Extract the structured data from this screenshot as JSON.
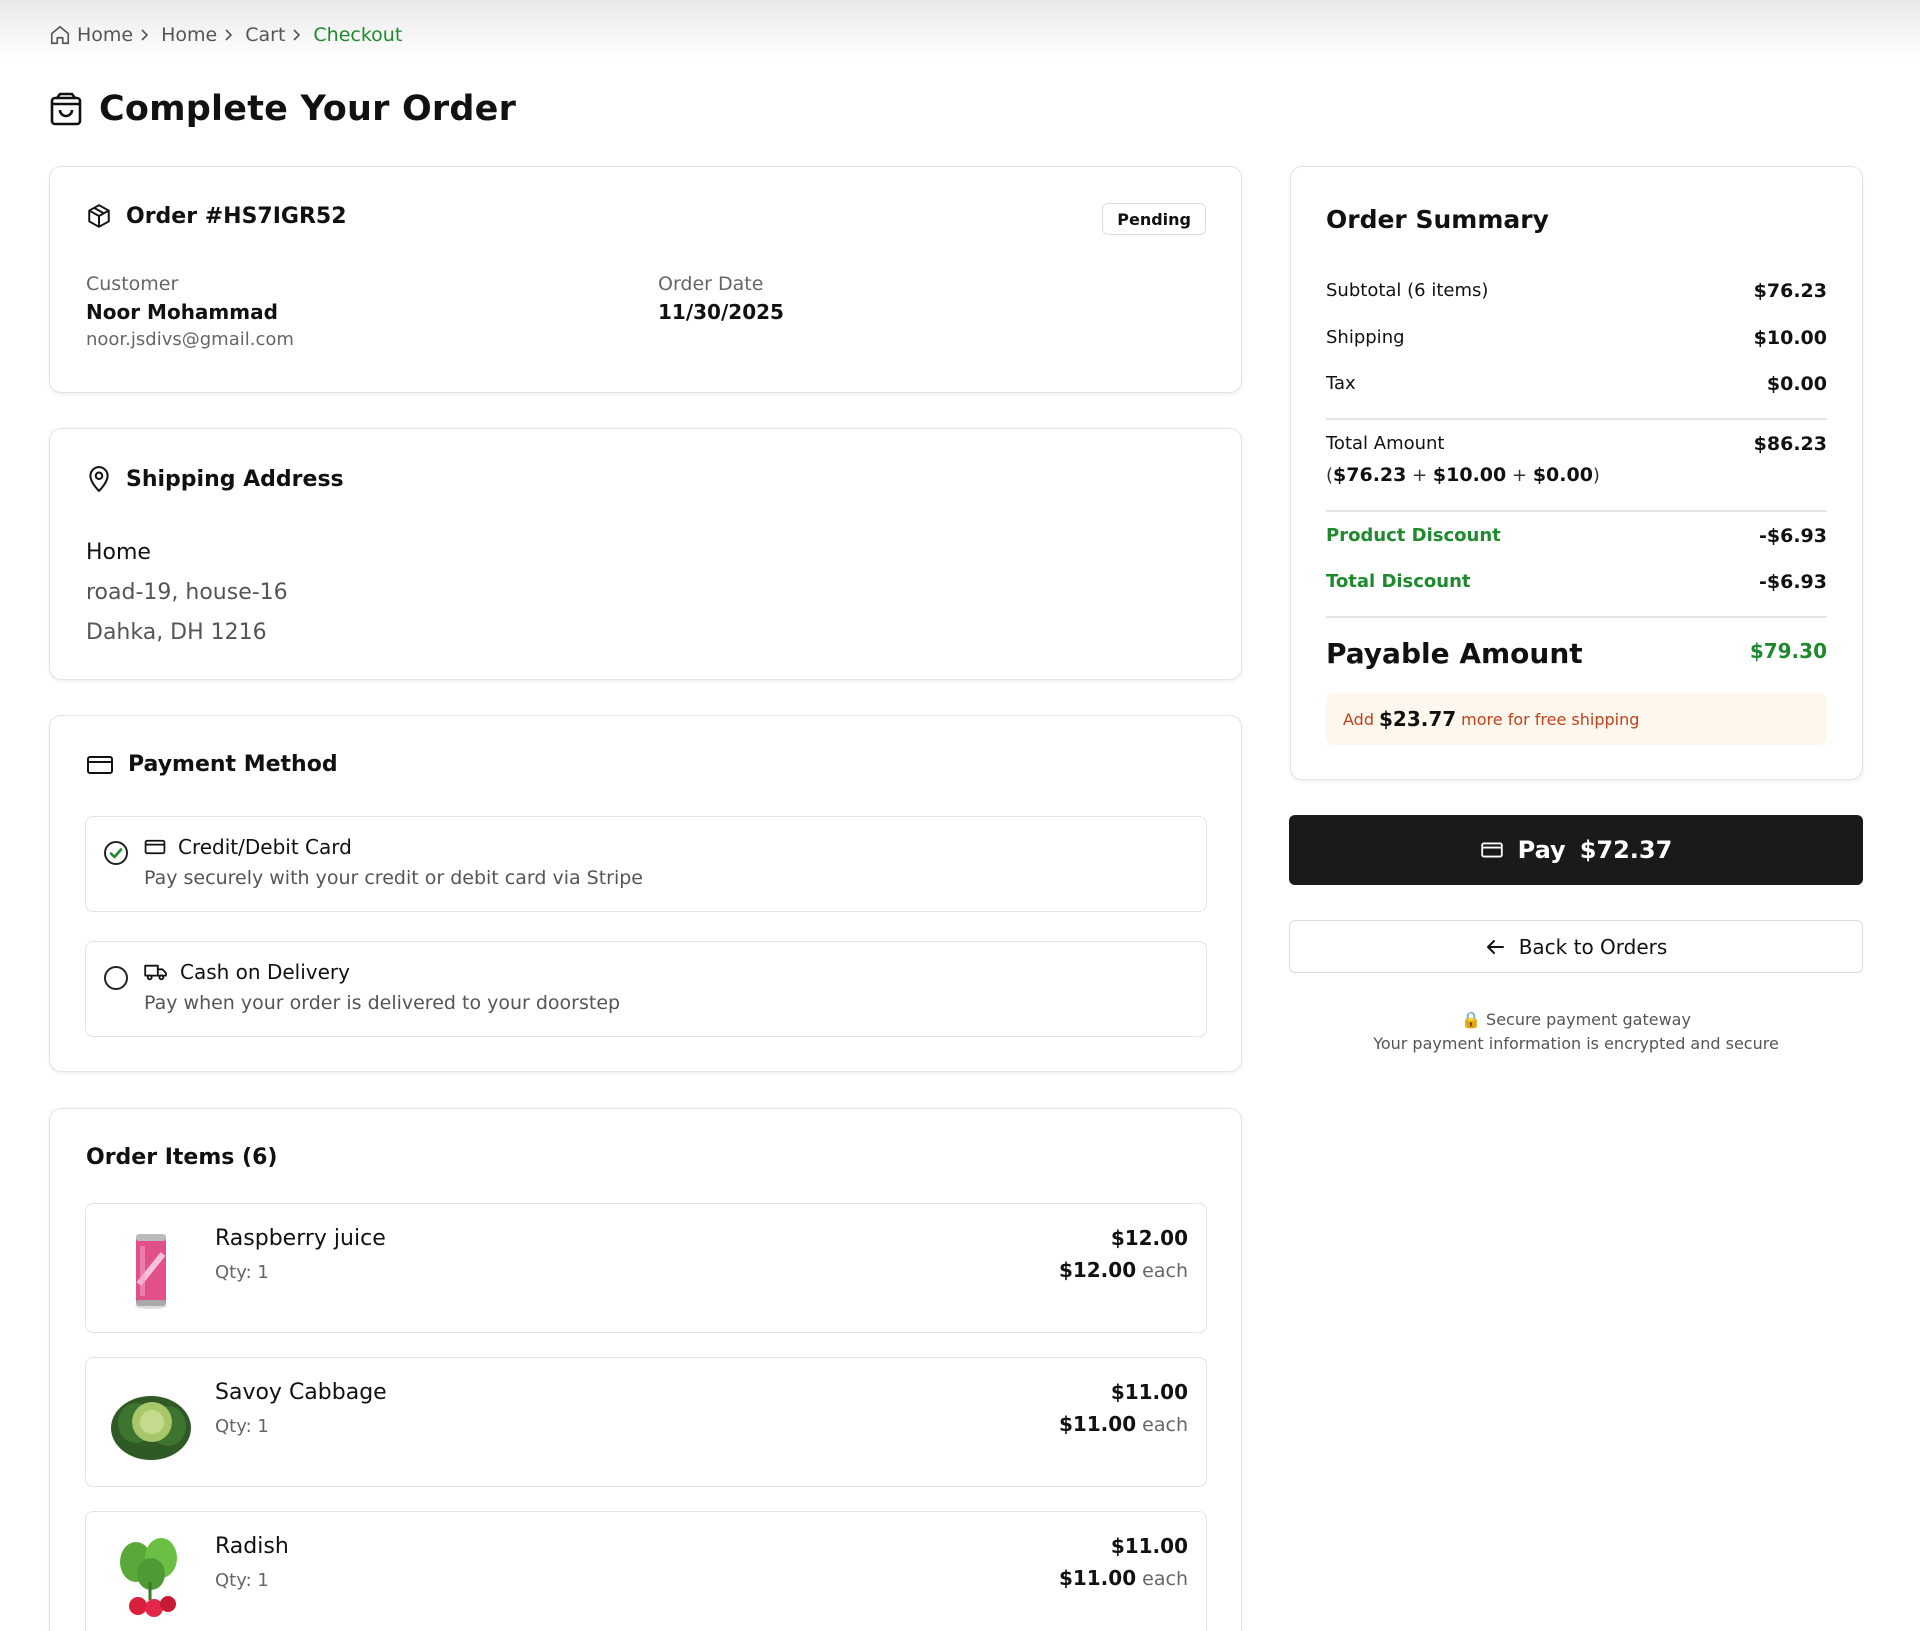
{
  "breadcrumb": {
    "items": [
      "Home",
      "Home",
      "Cart"
    ],
    "current": "Checkout"
  },
  "page": {
    "title": "Complete Your Order"
  },
  "order": {
    "heading": "Order #HS7IGR52",
    "status": "Pending",
    "customer_label": "Customer",
    "customer_name": "Noor Mohammad",
    "customer_email": "noor.jsdivs@gmail.com",
    "date_label": "Order Date",
    "date": "11/30/2025"
  },
  "shipping": {
    "heading": "Shipping Address",
    "name": "Home",
    "line1": "road-19, house-16",
    "line2": "Dahka, DH 1216"
  },
  "payment": {
    "heading": "Payment Method",
    "options": [
      {
        "title": "Credit/Debit Card",
        "desc": "Pay securely with your credit or debit card via Stripe",
        "selected": true
      },
      {
        "title": "Cash on Delivery",
        "desc": "Pay when your order is delivered to your doorstep",
        "selected": false
      }
    ]
  },
  "items": {
    "heading": "Order Items (6)",
    "list": [
      {
        "name": "Raspberry juice",
        "qty": "Qty: 1",
        "total": "$12.00",
        "unit": "$12.00",
        "each": "each",
        "image": "juice-can"
      },
      {
        "name": "Savoy Cabbage",
        "qty": "Qty: 1",
        "total": "$11.00",
        "unit": "$11.00",
        "each": "each",
        "image": "cabbage"
      },
      {
        "name": "Radish",
        "qty": "Qty: 1",
        "total": "$11.00",
        "unit": "$11.00",
        "each": "each",
        "image": "radish"
      }
    ]
  },
  "summary": {
    "title": "Order Summary",
    "subtotal_label": "Subtotal (6 items)",
    "subtotal": "$76.23",
    "shipping_label": "Shipping",
    "shipping": "$10.00",
    "tax_label": "Tax",
    "tax": "$0.00",
    "total_label": "Total Amount",
    "total": "$86.23",
    "breakdown": {
      "open": "(",
      "a": "$76.23",
      "plus1": "+",
      "b": "$10.00",
      "plus2": "+",
      "c": "$0.00",
      "close": ")"
    },
    "product_discount_label": "Product Discount",
    "product_discount": "-$6.93",
    "total_discount_label": "Total Discount",
    "total_discount": "-$6.93",
    "payable_label": "Payable Amount",
    "payable": "$79.30",
    "free_ship": {
      "prefix": "Add",
      "amount": "$23.77",
      "suffix": "more for free shipping"
    }
  },
  "actions": {
    "pay_label": "Pay",
    "pay_amount": "$72.37",
    "back_label": "Back to Orders"
  },
  "secure": {
    "line1": "🔒 Secure payment gateway",
    "line2": "Your payment information is encrypted and secure"
  },
  "colors": {
    "accent_green": "#1e8a2d",
    "warning_red": "#c2411b",
    "dark_button": "#1a1a1a"
  }
}
